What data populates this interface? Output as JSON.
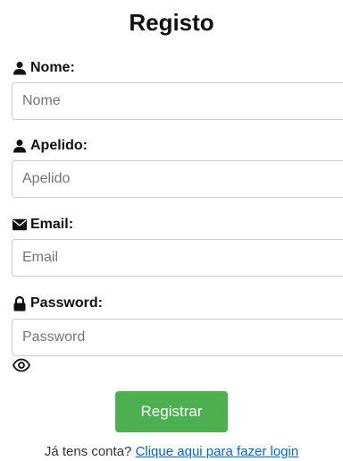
{
  "form": {
    "title": "Registo",
    "fields": [
      {
        "label": "Nome:",
        "placeholder": "Nome",
        "icon": "user-icon"
      },
      {
        "label": "Apelido:",
        "placeholder": "Apelido",
        "icon": "user-icon"
      },
      {
        "label": "Email:",
        "placeholder": "Email",
        "icon": "envelope-icon"
      },
      {
        "label": "Password:",
        "placeholder": "Password",
        "icon": "lock-icon"
      }
    ],
    "password_toggle_icon": "eye-icon",
    "submit_label": "Registrar",
    "login_prompt": "Já tens conta?",
    "login_link": "Clique aqui para fazer login"
  },
  "colors": {
    "button": "#4caf50",
    "link": "#0066cc"
  }
}
